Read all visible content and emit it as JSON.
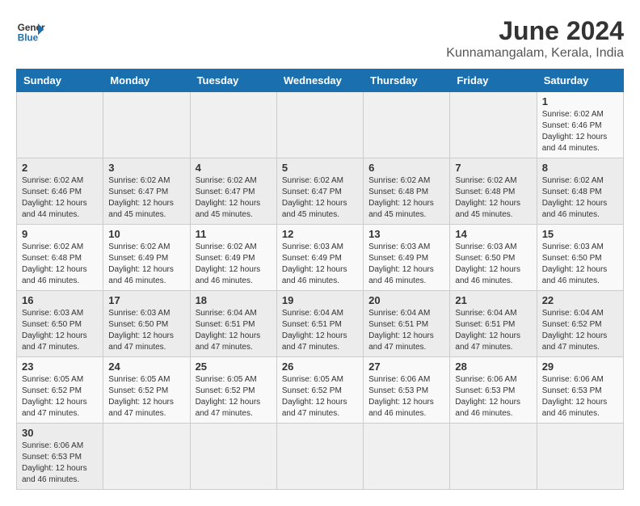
{
  "logo": {
    "text_general": "General",
    "text_blue": "Blue"
  },
  "title": "June 2024",
  "subtitle": "Kunnamangalam, Kerala, India",
  "days_of_week": [
    "Sunday",
    "Monday",
    "Tuesday",
    "Wednesday",
    "Thursday",
    "Friday",
    "Saturday"
  ],
  "weeks": [
    [
      null,
      null,
      null,
      null,
      null,
      null,
      {
        "day": "1",
        "sunrise": "Sunrise: 6:02 AM",
        "sunset": "Sunset: 6:46 PM",
        "daylight": "Daylight: 12 hours and 44 minutes."
      }
    ],
    [
      {
        "day": "2",
        "sunrise": "Sunrise: 6:02 AM",
        "sunset": "Sunset: 6:46 PM",
        "daylight": "Daylight: 12 hours and 44 minutes."
      },
      {
        "day": "3",
        "sunrise": "Sunrise: 6:02 AM",
        "sunset": "Sunset: 6:47 PM",
        "daylight": "Daylight: 12 hours and 45 minutes."
      },
      {
        "day": "4",
        "sunrise": "Sunrise: 6:02 AM",
        "sunset": "Sunset: 6:47 PM",
        "daylight": "Daylight: 12 hours and 45 minutes."
      },
      {
        "day": "5",
        "sunrise": "Sunrise: 6:02 AM",
        "sunset": "Sunset: 6:47 PM",
        "daylight": "Daylight: 12 hours and 45 minutes."
      },
      {
        "day": "6",
        "sunrise": "Sunrise: 6:02 AM",
        "sunset": "Sunset: 6:48 PM",
        "daylight": "Daylight: 12 hours and 45 minutes."
      },
      {
        "day": "7",
        "sunrise": "Sunrise: 6:02 AM",
        "sunset": "Sunset: 6:48 PM",
        "daylight": "Daylight: 12 hours and 45 minutes."
      },
      {
        "day": "8",
        "sunrise": "Sunrise: 6:02 AM",
        "sunset": "Sunset: 6:48 PM",
        "daylight": "Daylight: 12 hours and 46 minutes."
      }
    ],
    [
      {
        "day": "9",
        "sunrise": "Sunrise: 6:02 AM",
        "sunset": "Sunset: 6:48 PM",
        "daylight": "Daylight: 12 hours and 46 minutes."
      },
      {
        "day": "10",
        "sunrise": "Sunrise: 6:02 AM",
        "sunset": "Sunset: 6:49 PM",
        "daylight": "Daylight: 12 hours and 46 minutes."
      },
      {
        "day": "11",
        "sunrise": "Sunrise: 6:02 AM",
        "sunset": "Sunset: 6:49 PM",
        "daylight": "Daylight: 12 hours and 46 minutes."
      },
      {
        "day": "12",
        "sunrise": "Sunrise: 6:03 AM",
        "sunset": "Sunset: 6:49 PM",
        "daylight": "Daylight: 12 hours and 46 minutes."
      },
      {
        "day": "13",
        "sunrise": "Sunrise: 6:03 AM",
        "sunset": "Sunset: 6:49 PM",
        "daylight": "Daylight: 12 hours and 46 minutes."
      },
      {
        "day": "14",
        "sunrise": "Sunrise: 6:03 AM",
        "sunset": "Sunset: 6:50 PM",
        "daylight": "Daylight: 12 hours and 46 minutes."
      },
      {
        "day": "15",
        "sunrise": "Sunrise: 6:03 AM",
        "sunset": "Sunset: 6:50 PM",
        "daylight": "Daylight: 12 hours and 46 minutes."
      }
    ],
    [
      {
        "day": "16",
        "sunrise": "Sunrise: 6:03 AM",
        "sunset": "Sunset: 6:50 PM",
        "daylight": "Daylight: 12 hours and 47 minutes."
      },
      {
        "day": "17",
        "sunrise": "Sunrise: 6:03 AM",
        "sunset": "Sunset: 6:50 PM",
        "daylight": "Daylight: 12 hours and 47 minutes."
      },
      {
        "day": "18",
        "sunrise": "Sunrise: 6:04 AM",
        "sunset": "Sunset: 6:51 PM",
        "daylight": "Daylight: 12 hours and 47 minutes."
      },
      {
        "day": "19",
        "sunrise": "Sunrise: 6:04 AM",
        "sunset": "Sunset: 6:51 PM",
        "daylight": "Daylight: 12 hours and 47 minutes."
      },
      {
        "day": "20",
        "sunrise": "Sunrise: 6:04 AM",
        "sunset": "Sunset: 6:51 PM",
        "daylight": "Daylight: 12 hours and 47 minutes."
      },
      {
        "day": "21",
        "sunrise": "Sunrise: 6:04 AM",
        "sunset": "Sunset: 6:51 PM",
        "daylight": "Daylight: 12 hours and 47 minutes."
      },
      {
        "day": "22",
        "sunrise": "Sunrise: 6:04 AM",
        "sunset": "Sunset: 6:52 PM",
        "daylight": "Daylight: 12 hours and 47 minutes."
      }
    ],
    [
      {
        "day": "23",
        "sunrise": "Sunrise: 6:05 AM",
        "sunset": "Sunset: 6:52 PM",
        "daylight": "Daylight: 12 hours and 47 minutes."
      },
      {
        "day": "24",
        "sunrise": "Sunrise: 6:05 AM",
        "sunset": "Sunset: 6:52 PM",
        "daylight": "Daylight: 12 hours and 47 minutes."
      },
      {
        "day": "25",
        "sunrise": "Sunrise: 6:05 AM",
        "sunset": "Sunset: 6:52 PM",
        "daylight": "Daylight: 12 hours and 47 minutes."
      },
      {
        "day": "26",
        "sunrise": "Sunrise: 6:05 AM",
        "sunset": "Sunset: 6:52 PM",
        "daylight": "Daylight: 12 hours and 47 minutes."
      },
      {
        "day": "27",
        "sunrise": "Sunrise: 6:06 AM",
        "sunset": "Sunset: 6:53 PM",
        "daylight": "Daylight: 12 hours and 46 minutes."
      },
      {
        "day": "28",
        "sunrise": "Sunrise: 6:06 AM",
        "sunset": "Sunset: 6:53 PM",
        "daylight": "Daylight: 12 hours and 46 minutes."
      },
      {
        "day": "29",
        "sunrise": "Sunrise: 6:06 AM",
        "sunset": "Sunset: 6:53 PM",
        "daylight": "Daylight: 12 hours and 46 minutes."
      }
    ],
    [
      {
        "day": "30",
        "sunrise": "Sunrise: 6:06 AM",
        "sunset": "Sunset: 6:53 PM",
        "daylight": "Daylight: 12 hours and 46 minutes."
      },
      null,
      null,
      null,
      null,
      null,
      null
    ]
  ],
  "colors": {
    "header_bg": "#1a6faf",
    "odd_row": "#f9f9f9",
    "even_row": "#ececec"
  }
}
